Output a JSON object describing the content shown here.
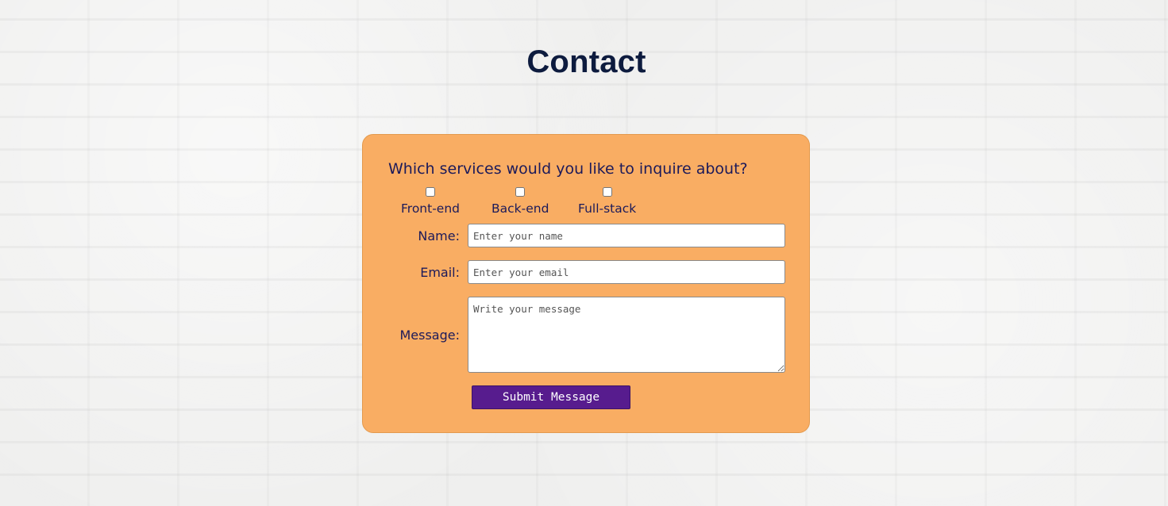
{
  "page": {
    "title": "Contact"
  },
  "form": {
    "question": "Which services would you like to inquire about?",
    "services": [
      {
        "label": "Front-end",
        "checked": false
      },
      {
        "label": "Back-end",
        "checked": false
      },
      {
        "label": "Full-stack",
        "checked": false
      }
    ],
    "name_label": "Name:",
    "name_placeholder": "Enter your name",
    "email_label": "Email:",
    "email_placeholder": "Enter your email",
    "message_label": "Message:",
    "message_placeholder": "Write your message",
    "submit_label": "Submit Message"
  },
  "colors": {
    "card_background": "#f9ad63",
    "title_text": "#0d1b3e",
    "label_text": "#1c1a5a",
    "submit_background": "#571c8e"
  }
}
